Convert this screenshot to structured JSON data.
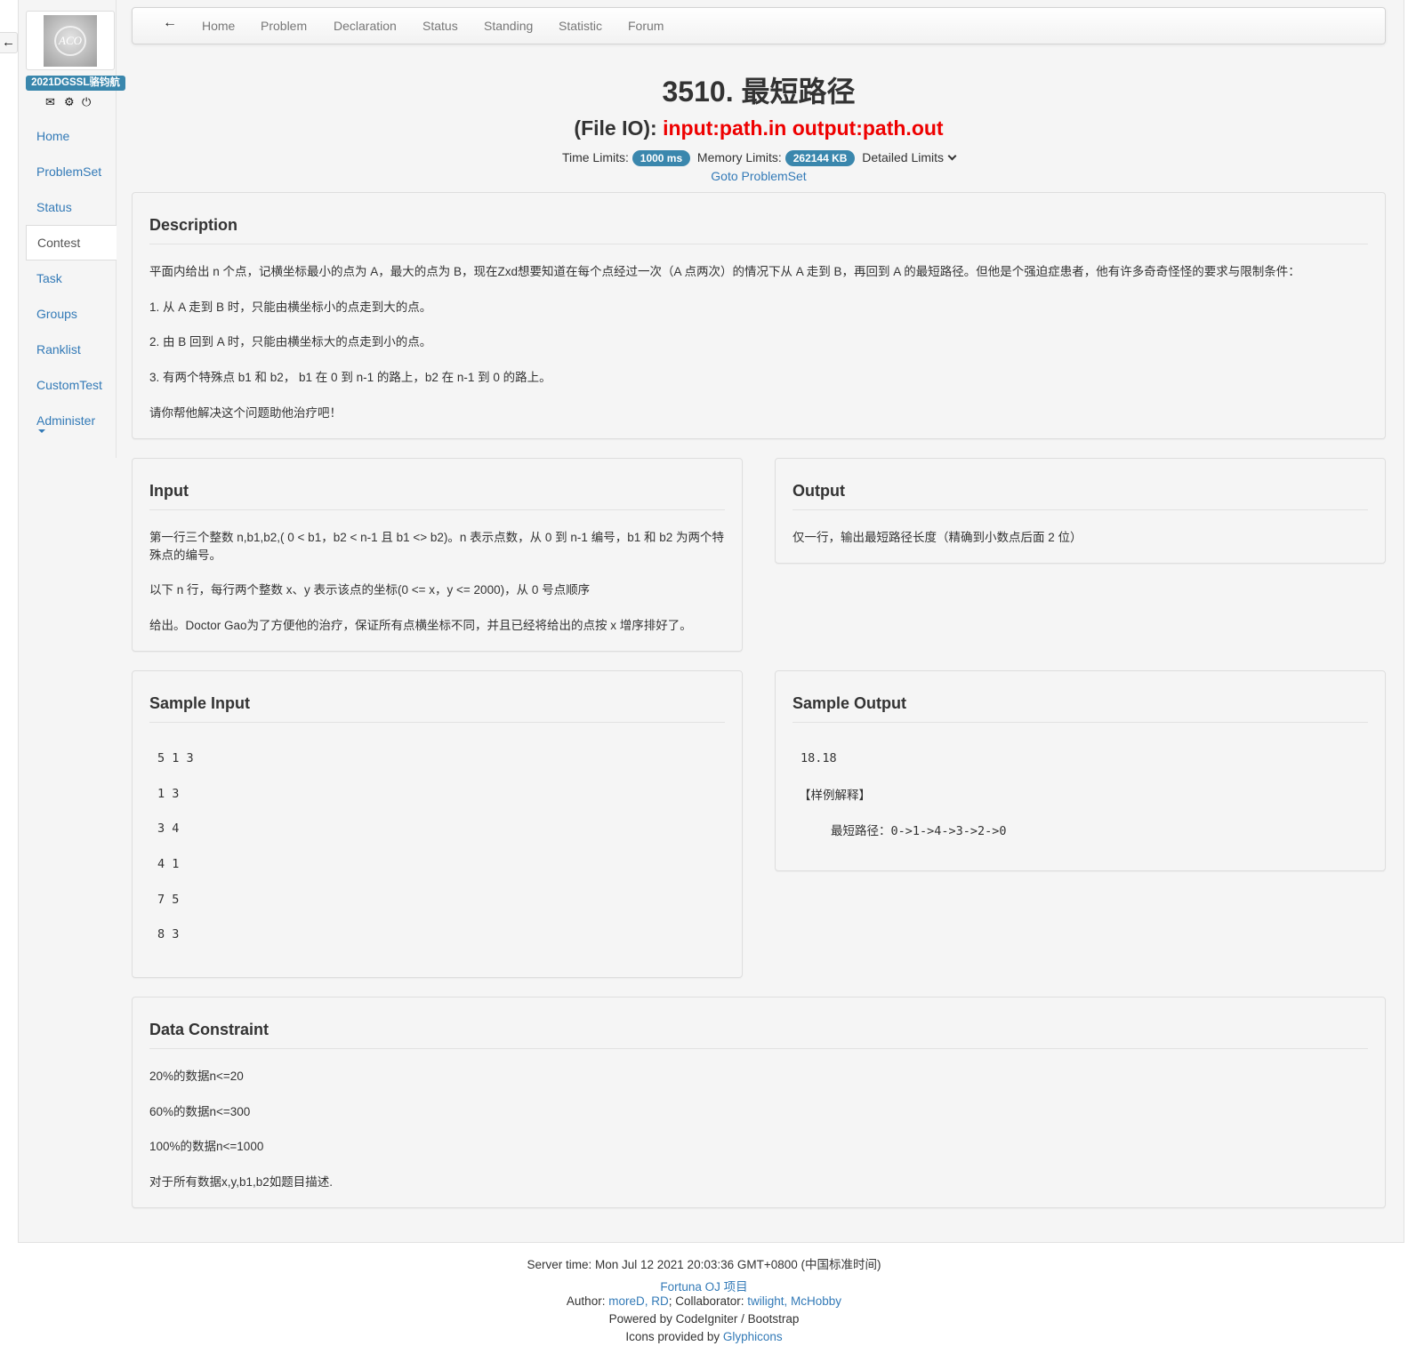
{
  "sidebar": {
    "avatar_text": "ACO",
    "username": "2021DGSSL骆钧航",
    "items": [
      {
        "label": "Home"
      },
      {
        "label": "ProblemSet"
      },
      {
        "label": "Status"
      },
      {
        "label": "Contest"
      },
      {
        "label": "Task"
      },
      {
        "label": "Groups"
      },
      {
        "label": "Ranklist"
      },
      {
        "label": "CustomTest"
      },
      {
        "label": "Administer"
      }
    ],
    "active_index": 3,
    "icons": [
      "envelope-icon",
      "gear-icon",
      "power-icon"
    ]
  },
  "topnav": {
    "back_icon": "arrow-left-icon",
    "items": [
      "Home",
      "Problem",
      "Declaration",
      "Status",
      "Standing",
      "Statistic",
      "Forum"
    ]
  },
  "problem": {
    "title": "3510. 最短路径",
    "fileio_label": "(File IO): ",
    "fileio_value": "input:path.in output:path.out",
    "time_label": "Time Limits:",
    "time_value": "1000 ms",
    "memory_label": "Memory Limits:",
    "memory_value": "262144 KB",
    "detailed_label": "Detailed Limits",
    "goto_label": "Goto ProblemSet"
  },
  "description": {
    "heading": "Description",
    "paragraphs": [
      "平面内给出 n 个点，记横坐标最小的点为 A，最大的点为 B，现在Zxd想要知道在每个点经过一次（A 点两次）的情况下从 A 走到 B，再回到 A 的最短路径。但他是个强迫症患者，他有许多奇奇怪怪的要求与限制条件：",
      "1.  从 A 走到 B 时，只能由横坐标小的点走到大的点。",
      "2.  由 B 回到 A 时，只能由横坐标大的点走到小的点。",
      "3.  有两个特殊点 b1 和 b2， b1 在 0 到 n-1 的路上，b2 在 n-1 到 0 的路上。",
      "请你帮他解决这个问题助他治疗吧！"
    ]
  },
  "input": {
    "heading": "Input",
    "paragraphs": [
      "第一行三个整数 n,b1,b2,( 0 < b1，b2 < n-1 且 b1 <> b2)。n 表示点数，从 0 到 n-1 编号，b1 和 b2 为两个特殊点的编号。",
      "以下 n 行，每行两个整数 x、y 表示该点的坐标(0 <= x，y <= 2000)，从 0 号点顺序",
      "给出。Doctor Gao为了方便他的治疗，保证所有点横坐标不同，并且已经将给出的点按 x 增序排好了。"
    ]
  },
  "output": {
    "heading": "Output",
    "paragraphs": [
      "仅一行，输出最短路径长度（精确到小数点后面 2 位）"
    ]
  },
  "sample_input": {
    "heading": "Sample Input",
    "lines": [
      "5 1 3",
      "1 3",
      "3 4",
      "4 1",
      "7 5",
      "8 3"
    ]
  },
  "sample_output": {
    "heading": "Sample Output",
    "value": "18.18",
    "explain_title": "【样例解释】",
    "explain_line": "最短路径：0->1->4->3->2->0"
  },
  "constraint": {
    "heading": "Data Constraint",
    "paragraphs": [
      "20%的数据n<=20",
      "60%的数据n<=300",
      "100%的数据n<=1000",
      "对于所有数据x,y,b1,b2如题目描述."
    ]
  },
  "footer": {
    "server_time": "Server time: Mon Jul 12 2021 20:03:36 GMT+0800 (中国标准时间)",
    "project": "Fortuna OJ 项目",
    "author_label": "Author: ",
    "authors": "moreD, RD",
    "collab_label": "; Collaborator: ",
    "collaborators": "twilight, McHobby",
    "powered": "Powered by CodeIgniter / Bootstrap",
    "icons_label": "Icons provided by ",
    "icons_link": "Glyphicons"
  }
}
